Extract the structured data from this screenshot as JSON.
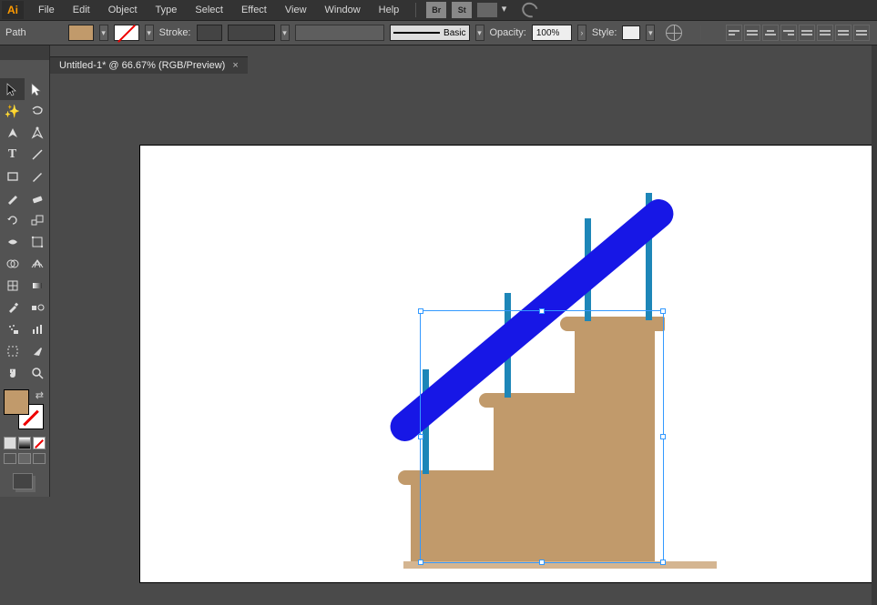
{
  "app": {
    "logo_text": "Ai"
  },
  "menus": [
    "File",
    "Edit",
    "Object",
    "Type",
    "Select",
    "Effect",
    "View",
    "Window",
    "Help"
  ],
  "bridge_badges": [
    "Br",
    "St"
  ],
  "control": {
    "sel_label": "Path",
    "stroke_label": "Stroke:",
    "brush_label": "Basic",
    "opacity_label": "Opacity:",
    "opacity_value": "100%",
    "style_label": "Style:",
    "fill_color": "#c19a6b"
  },
  "document": {
    "tab_title": "Untitled-1* @ 66.67% (RGB/Preview)",
    "close_glyph": "×"
  },
  "tools_header": "",
  "artwork": {
    "stair_color": "#c19a6b",
    "tread_color": "#c19a6b",
    "floor_color": "#d4b591",
    "baluster_color": "#1d86b8",
    "handrail_color": "#1717e6"
  }
}
